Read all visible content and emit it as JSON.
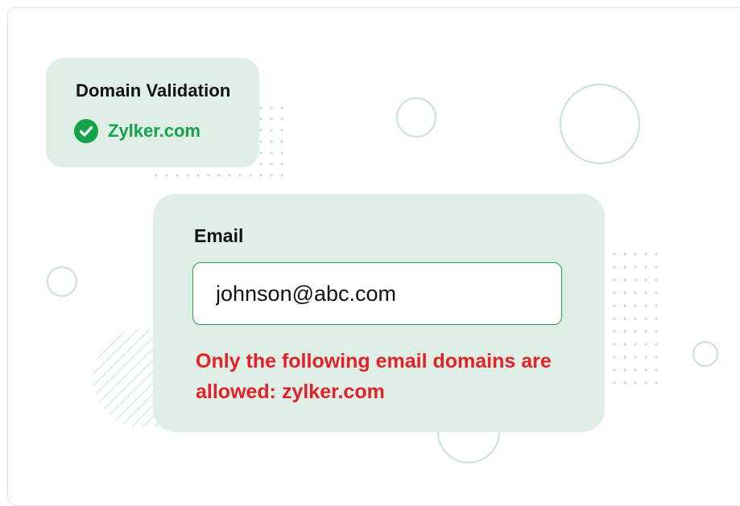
{
  "domain_validation": {
    "title": "Domain Validation",
    "domain": "Zylker.com",
    "status_icon": "check-circle-icon"
  },
  "email_form": {
    "label": "Email",
    "value": "johnson@abc.com",
    "error": "Only the following email domains are allowed: zylker.com"
  },
  "colors": {
    "card_bg": "#e0efe5",
    "success": "#13a349",
    "error": "#e32127",
    "input_border": "#22a04f",
    "decor": "#cfe6d8"
  }
}
